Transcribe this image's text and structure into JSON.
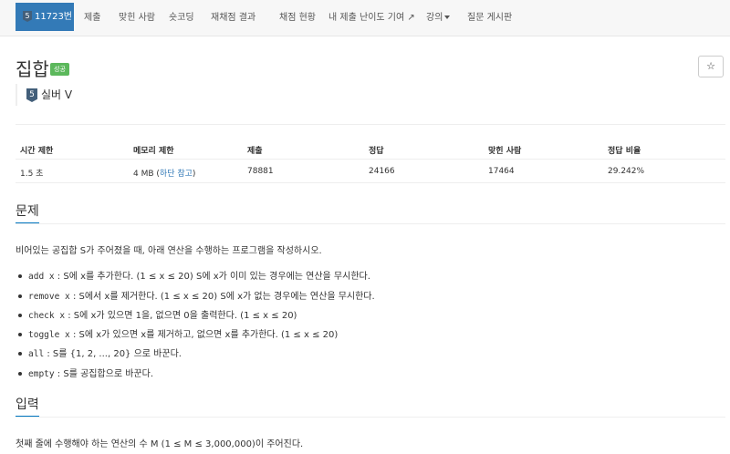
{
  "nav": {
    "problem_number": "11723번",
    "tier_digit": "5",
    "items": [
      "제출",
      "맞힌 사람",
      "숏코딩",
      "재채점 결과",
      "채점 현황",
      "내 제출",
      "난이도 기여",
      "강의",
      "질문 게시판"
    ]
  },
  "problem": {
    "title": "집합",
    "status_badge": "성공",
    "star": "☆",
    "tier_digit": "5",
    "tier_label": "실버 V"
  },
  "info_table": {
    "headers": [
      "시간 제한",
      "메모리 제한",
      "제출",
      "정답",
      "맞힌 사람",
      "정답 비율"
    ],
    "time_limit": "1.5 초",
    "memory_limit": "4 MB",
    "memory_paren_open": "(",
    "memory_note": "하단 참고",
    "memory_paren_close": ")",
    "submissions": "78881",
    "accepted": "24166",
    "solvers": "17464",
    "ratio": "29.242%"
  },
  "sections": {
    "problem_heading": "문제",
    "problem_intro": "비어있는 공집합 S가 주어졌을 때, 아래 연산을 수행하는 프로그램을 작성하시오.",
    "operations": [
      {
        "code": "add x",
        "text": ": S에 x를 추가한다. (1 ≤ x ≤ 20) S에 x가 이미 있는 경우에는 연산을 무시한다."
      },
      {
        "code": "remove x",
        "text": ": S에서 x를 제거한다. (1 ≤ x ≤ 20) S에 x가 없는 경우에는 연산을 무시한다."
      },
      {
        "code": "check x",
        "text": ": S에 x가 있으면 1을, 없으면 0을 출력한다. (1 ≤ x ≤ 20)"
      },
      {
        "code": "toggle x",
        "text": ": S에 x가 있으면 x를 제거하고, 없으면 x를 추가한다. (1 ≤ x ≤ 20)"
      },
      {
        "code": "all",
        "text": ": S를 {1, 2, ..., 20} 으로 바꾼다."
      },
      {
        "code": "empty",
        "text": ": S를 공집합으로 바꾼다."
      }
    ],
    "input_heading": "입력",
    "input_text": "첫째 줄에 수행해야 하는 연산의 수 M (1 ≤ M ≤ 3,000,000)이 주어진다."
  }
}
